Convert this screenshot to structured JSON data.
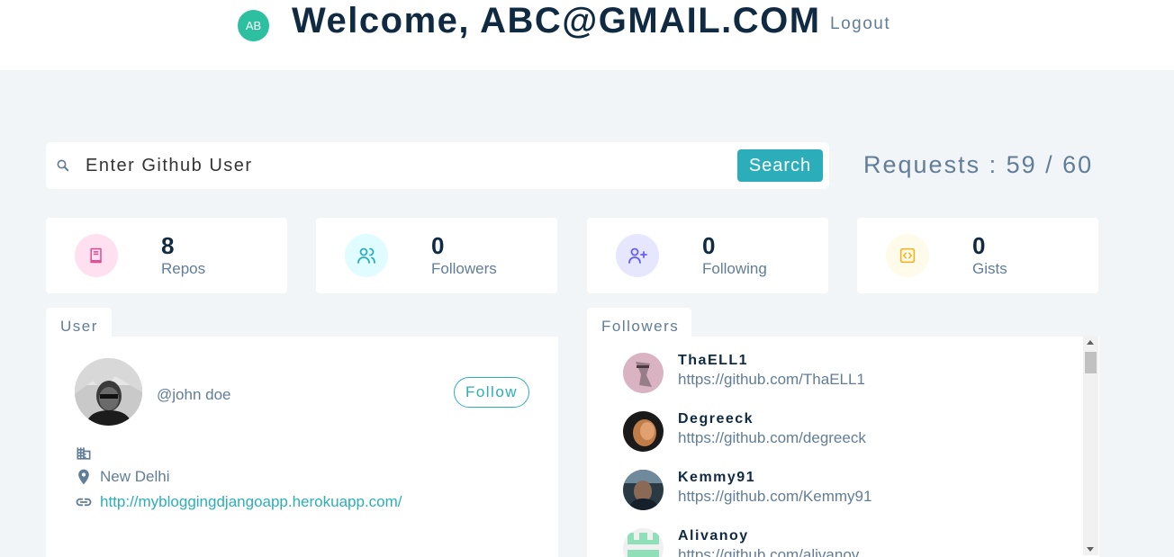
{
  "header": {
    "avatar_initials": "AB",
    "welcome": "Welcome, ABC@GMAIL.COM",
    "logout": "Logout"
  },
  "search": {
    "placeholder": "Enter Github User",
    "button": "Search",
    "requests": "Requests : 59 / 60"
  },
  "stats": [
    {
      "value": "8",
      "label": "Repos",
      "icon": "book-icon",
      "color": "#da4a91",
      "bg": "#ffe0f0"
    },
    {
      "value": "0",
      "label": "Followers",
      "icon": "users-icon",
      "color": "#2caeba",
      "bg": "#e0fcff"
    },
    {
      "value": "0",
      "label": "Following",
      "icon": "user-plus-icon",
      "color": "#645cff",
      "bg": "#e6e6ff"
    },
    {
      "value": "0",
      "label": "Gists",
      "icon": "code-icon",
      "color": "#f0b429",
      "bg": "#fffbea"
    }
  ],
  "user": {
    "tab": "User",
    "handle": "@john doe",
    "follow": "Follow",
    "company": "",
    "location": "New Delhi",
    "blog": "http://mybloggingdjangoapp.herokuapp.com/"
  },
  "followers": {
    "tab": "Followers",
    "items": [
      {
        "name": "ThaELL1",
        "url": "https://github.com/ThaELL1"
      },
      {
        "name": "Degreeck",
        "url": "https://github.com/degreeck"
      },
      {
        "name": "Kemmy91",
        "url": "https://github.com/Kemmy91"
      },
      {
        "name": "Alivanoy",
        "url": "https://github.com/alivanoy"
      }
    ]
  }
}
